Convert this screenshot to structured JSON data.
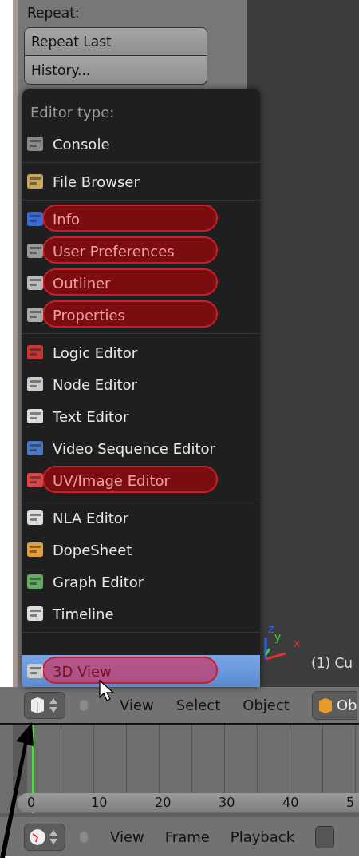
{
  "tool_panel": {
    "label": "Repeat:",
    "buttons": [
      "Repeat Last",
      "History..."
    ]
  },
  "menu": {
    "title": "Editor type:",
    "groups": [
      [
        {
          "label": "Console",
          "highlighted": false,
          "selected": false
        }
      ],
      [
        {
          "label": "File Browser",
          "highlighted": false,
          "selected": false
        }
      ],
      [
        {
          "label": "Info",
          "highlighted": true,
          "selected": false
        },
        {
          "label": "User Preferences",
          "highlighted": true,
          "selected": false
        },
        {
          "label": "Outliner",
          "highlighted": true,
          "selected": false
        },
        {
          "label": "Properties",
          "highlighted": true,
          "selected": false
        }
      ],
      [
        {
          "label": "Logic Editor",
          "highlighted": false,
          "selected": false
        },
        {
          "label": "Node Editor",
          "highlighted": false,
          "selected": false
        },
        {
          "label": "Text Editor",
          "highlighted": false,
          "selected": false
        },
        {
          "label": "Video Sequence Editor",
          "highlighted": false,
          "selected": false
        },
        {
          "label": "UV/Image Editor",
          "highlighted": true,
          "selected": false
        }
      ],
      [
        {
          "label": "NLA Editor",
          "highlighted": false,
          "selected": false
        },
        {
          "label": "DopeSheet",
          "highlighted": false,
          "selected": false
        },
        {
          "label": "Graph Editor",
          "highlighted": false,
          "selected": false
        },
        {
          "label": "Timeline",
          "highlighted": false,
          "selected": false
        }
      ],
      [
        {
          "label": "3D View",
          "highlighted": true,
          "selected": true
        }
      ]
    ]
  },
  "viewport": {
    "axes": [
      "z",
      "y",
      "x"
    ],
    "object_info": "(1) Cu"
  },
  "view_header": {
    "menus": [
      "View",
      "Select",
      "Object"
    ],
    "mode_button": "Ob"
  },
  "timeline": {
    "ticks": [
      "0",
      "10",
      "20",
      "30",
      "40",
      "5"
    ]
  },
  "timeline_header": {
    "menus": [
      "View",
      "Frame",
      "Playback"
    ],
    "checkbox": {
      "checked": false
    }
  }
}
